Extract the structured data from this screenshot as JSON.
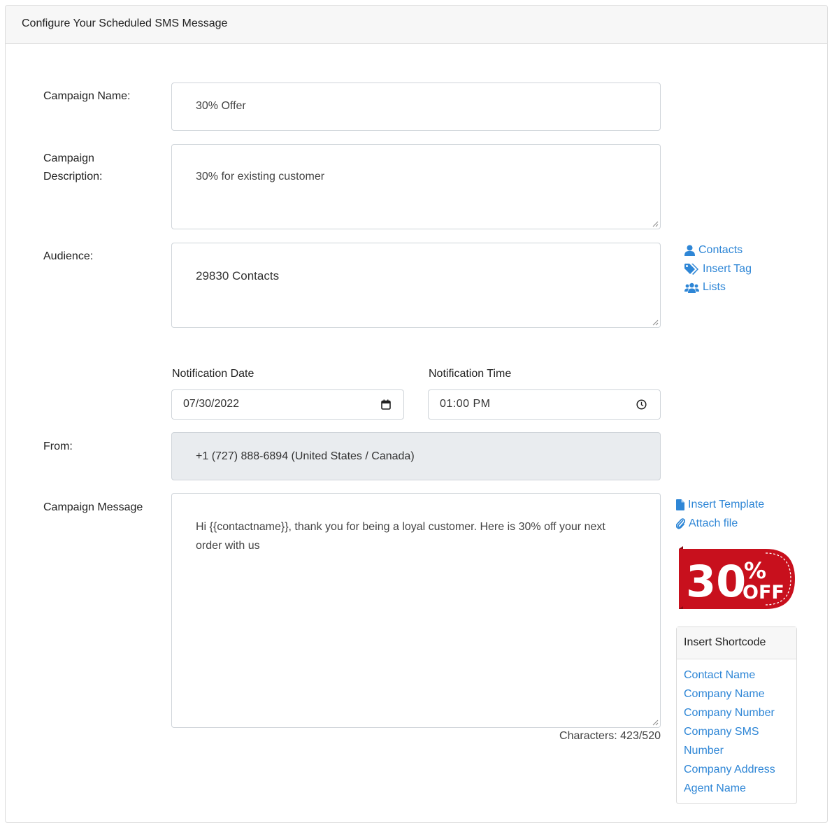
{
  "header": {
    "title": "Configure Your Scheduled SMS Message"
  },
  "campaign_name": {
    "label": "Campaign Name:",
    "value": "30% Offer"
  },
  "campaign_description": {
    "label_line1": "Campaign",
    "label_line2": "Description:",
    "value": "30% for existing customer"
  },
  "audience": {
    "label": "Audience:",
    "value": "29830 Contacts",
    "links": {
      "contacts": "Contacts",
      "insert_tag": "Insert Tag",
      "lists": "Lists"
    }
  },
  "notification_date": {
    "label": "Notification Date",
    "value": "07/30/2022"
  },
  "notification_time": {
    "label": "Notification Time",
    "value": "01:00 PM"
  },
  "from": {
    "label": "From:",
    "value": "+1 (727) 888-6894 (United States / Canada)"
  },
  "campaign_message": {
    "label": "Campaign Message",
    "line1": "Hi {{contactname}}, thank you for being a loyal customer. Here is 30% off your next",
    "line2": "order with us",
    "characters": "Characters: 423/520",
    "links": {
      "insert_template": "Insert Template",
      "attach_file": "Attach file"
    }
  },
  "promo_image": {
    "number": "30",
    "percent": "%",
    "off": "OFF"
  },
  "shortcode": {
    "title": "Insert Shortcode",
    "items": [
      "Contact Name",
      "Company Name",
      "Company Number",
      "Company SMS",
      "Number",
      "Company Address",
      "Agent Name"
    ]
  },
  "colors": {
    "link": "#2e86d6",
    "promo_red": "#c8101d",
    "disabled_bg": "#e9ecef"
  }
}
